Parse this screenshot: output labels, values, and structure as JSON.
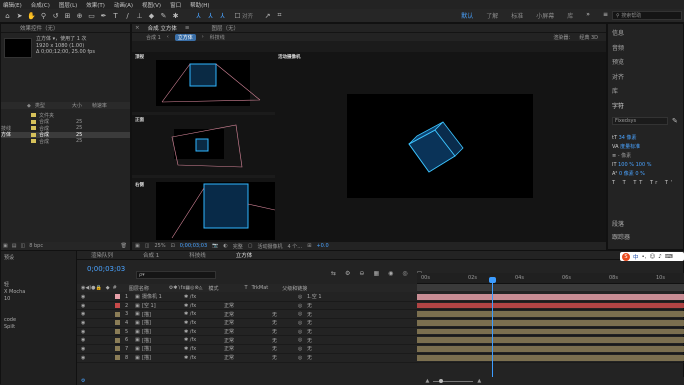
{
  "menu": [
    "编辑(E)",
    "合成(C)",
    "图层(L)",
    "效果(T)",
    "动画(A)",
    "视图(V)",
    "窗口",
    "帮助(H)"
  ],
  "toolbar": {
    "align_label": "对齐",
    "workspaces": [
      "默认",
      "了解",
      "标准",
      "小屏幕",
      "库"
    ],
    "search_placeholder": "搜索帮助"
  },
  "project": {
    "tab": "效果控件（无）",
    "comp_name": "立方体 ▾，使用了 1 次",
    "comp_size": "1920 x 1080 (1.00)",
    "comp_duration": "Δ 0;00;12;00, 25.00 fps",
    "col_type": "类型",
    "col_size": "大小",
    "col_rate": "帧速率",
    "rows": [
      {
        "name": "",
        "type": "文件夹",
        "size": "",
        "rate": "",
        "color": "#d6c15a"
      },
      {
        "name": "",
        "type": "合成",
        "size": "",
        "rate": "25",
        "color": "#d6c15a"
      },
      {
        "name": "技线",
        "type": "合成",
        "size": "",
        "rate": "25",
        "color": "#d6c15a"
      },
      {
        "name": "方体",
        "type": "合成",
        "size": "",
        "rate": "25",
        "color": "#d6c15a"
      },
      {
        "name": "",
        "type": "合成",
        "size": "",
        "rate": "25",
        "color": "#d6c15a"
      }
    ],
    "bpc": "8 bpc"
  },
  "comp": {
    "tab": "合成 立方体",
    "layer_tab": "图层（无）",
    "breadcrumb": [
      "合成 1",
      "立方体",
      "科技线"
    ],
    "renderer_label": "渲染器：",
    "renderer": "经典 3D",
    "views": [
      "顶视",
      "正面",
      "右侧"
    ],
    "camera_label": "活动摄像机",
    "zoom": "25%",
    "timecode": "0;00;03;03",
    "quality": "完整",
    "camera": "活动摄像机",
    "view_count": "4 个…",
    "exposure": "+0.0"
  },
  "right": {
    "items": [
      "信息",
      "音频",
      "预览",
      "对齐",
      "库",
      "字符"
    ],
    "font": "Fixedsys",
    "size_val": "34 像素",
    "spacing_label": "度量标准",
    "px_label": "像素",
    "px_val": "- 像素",
    "scale_v": "100 %",
    "scale_h": "100 %",
    "baseline": "0 像素",
    "tsume": "0 %",
    "bottom_items": [
      "段落",
      "跟踪器"
    ],
    "formats": [
      "T",
      "T",
      "TT",
      "Tr",
      "T'"
    ]
  },
  "timeline": {
    "tabs": [
      "渲染队列",
      "合成 1",
      "科技线",
      "立方体"
    ],
    "timecode": "0;00;03;03",
    "search_placeholder": "ρ▾",
    "col_name": "图层名称",
    "col_mode": "模式",
    "col_t": "T",
    "col_trkmat": "TrkMat",
    "col_parent": "父级和链接",
    "ruler": [
      "00s",
      "02s",
      "04s",
      "06s",
      "08s",
      "10s"
    ],
    "rows": [
      {
        "num": "1",
        "name": "摄像机 1",
        "mode": "",
        "trkmat": "",
        "parent": "1.空 1",
        "color": "#e6a0a8"
      },
      {
        "num": "2",
        "name": "[空 1]",
        "mode": "正常",
        "trkmat": "",
        "parent": "无",
        "color": "#c84a4a"
      },
      {
        "num": "3",
        "name": "[描]",
        "mode": "正常",
        "trkmat": "无",
        "parent": "无",
        "color": "#8b7d57"
      },
      {
        "num": "4",
        "name": "[描]",
        "mode": "正常",
        "trkmat": "无",
        "parent": "无",
        "color": "#8b7d57"
      },
      {
        "num": "5",
        "name": "[描]",
        "mode": "正常",
        "trkmat": "无",
        "parent": "无",
        "color": "#8b7d57"
      },
      {
        "num": "6",
        "name": "[描]",
        "mode": "正常",
        "trkmat": "无",
        "parent": "无",
        "color": "#8b7d57"
      },
      {
        "num": "7",
        "name": "[描]",
        "mode": "正常",
        "trkmat": "无",
        "parent": "无",
        "color": "#8b7d57"
      },
      {
        "num": "8",
        "name": "[描]",
        "mode": "正常",
        "trkmat": "无",
        "parent": "无",
        "color": "#8b7d57"
      }
    ],
    "left_items": [
      "预设",
      "轻",
      "X Mocha",
      "10",
      "",
      "code",
      "Spilt"
    ]
  },
  "ime": {
    "label": "中"
  }
}
